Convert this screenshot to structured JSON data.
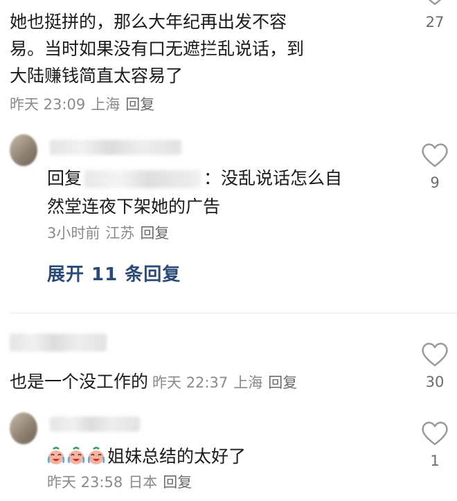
{
  "comments": [
    {
      "body_lines": [
        "她也挺拼的，那么大年纪再出发不容",
        "易。当时如果没有口无遮拦乱说话，到",
        "大陆赚钱简直太容易了"
      ],
      "time": "昨天 23:09",
      "location": "上海",
      "reply_label": "回复",
      "likes": "27"
    },
    {
      "reply_prefix": "回复",
      "body_line1_after": "：没乱说话怎么自",
      "body_line2": "然堂连夜下架她的广告",
      "time": "3小时前",
      "location": "江苏",
      "reply_label": "回复",
      "likes": "9",
      "expand_label": "展开 11 条回复"
    },
    {
      "body": "也是一个没工作的",
      "time": "昨天 22:37",
      "location": "上海",
      "reply_label": "回复",
      "likes": "30"
    },
    {
      "body": "姐妹总结的太好了",
      "emoji_count": 3,
      "time": "昨天 23:58",
      "location": "日本",
      "reply_label": "回复",
      "likes": "1"
    }
  ],
  "icons": {
    "like": "heart-outline-icon",
    "emoji": "crying-laughing-emoji-icon"
  },
  "colors": {
    "body_text": "#1a1a1a",
    "meta_text": "#8a8a8a",
    "link_blue": "#2a4a78",
    "heart_stroke": "#9a9a9a"
  }
}
